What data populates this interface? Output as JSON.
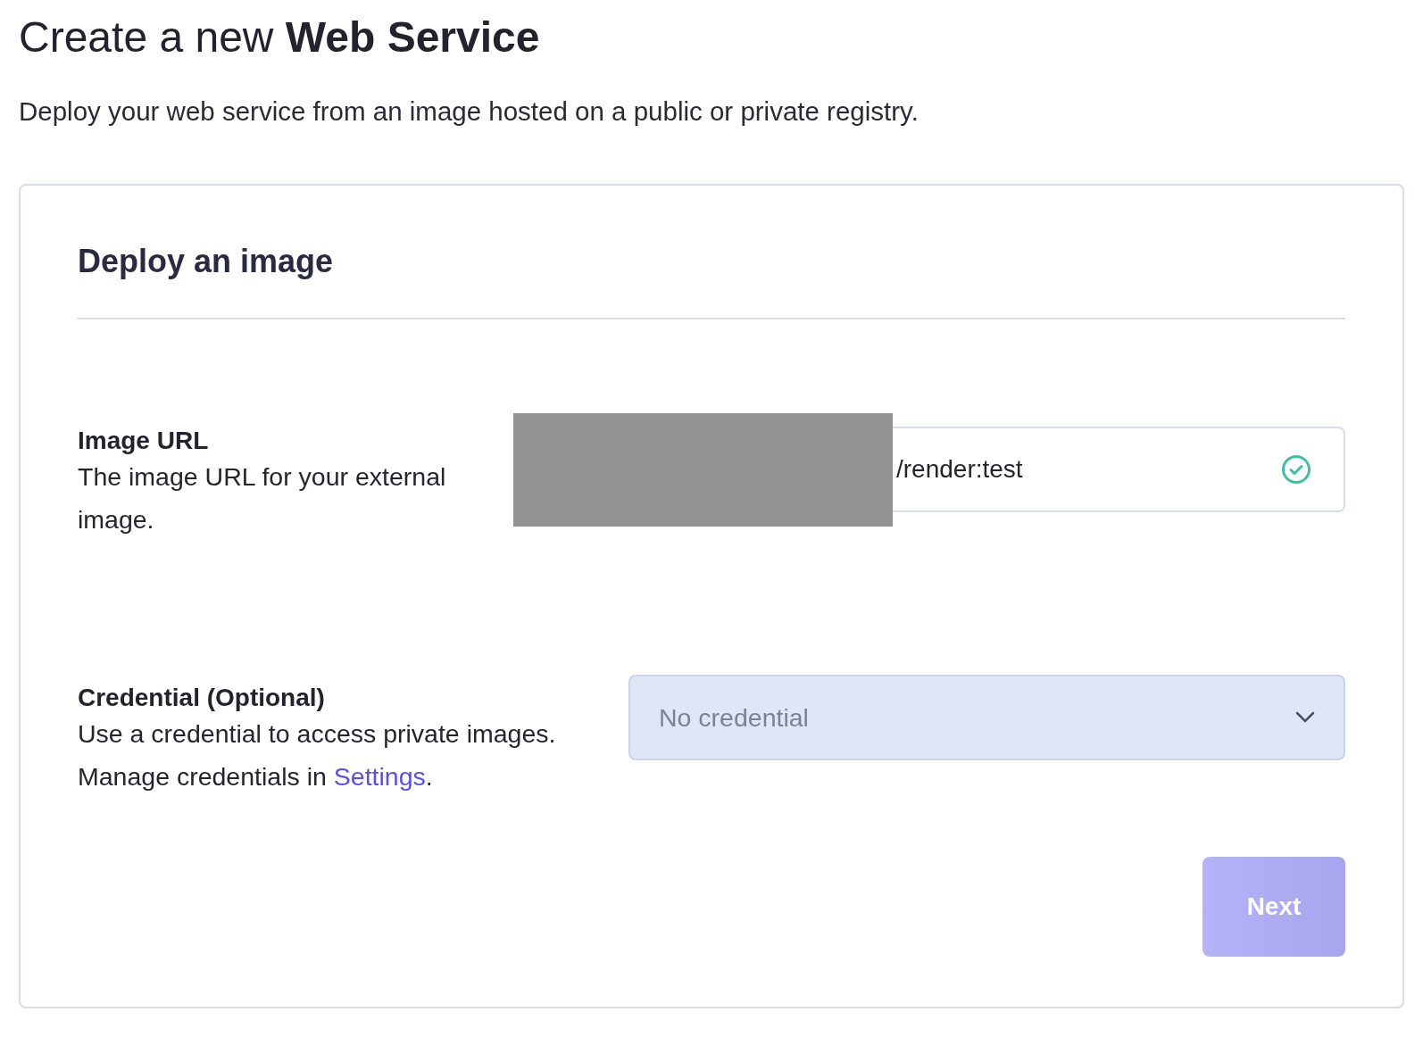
{
  "heading": {
    "prefix": "Create a new",
    "emphasis": "Web Service"
  },
  "subtitle": "Deploy your web service from an image hosted on a public or private registry.",
  "card": {
    "title": "Deploy an image",
    "image_url": {
      "label": "Image URL",
      "description": "The image URL for your external image.",
      "value": "/render:test",
      "valid": true
    },
    "credential": {
      "label": "Credential (Optional)",
      "description": "Use a credential to access private images.",
      "manage_prefix": "Manage credentials in",
      "link": "Settings",
      "suffix": ".",
      "placeholder": "No credential"
    },
    "next_button": {
      "label": "Next",
      "disabled": true
    }
  }
}
